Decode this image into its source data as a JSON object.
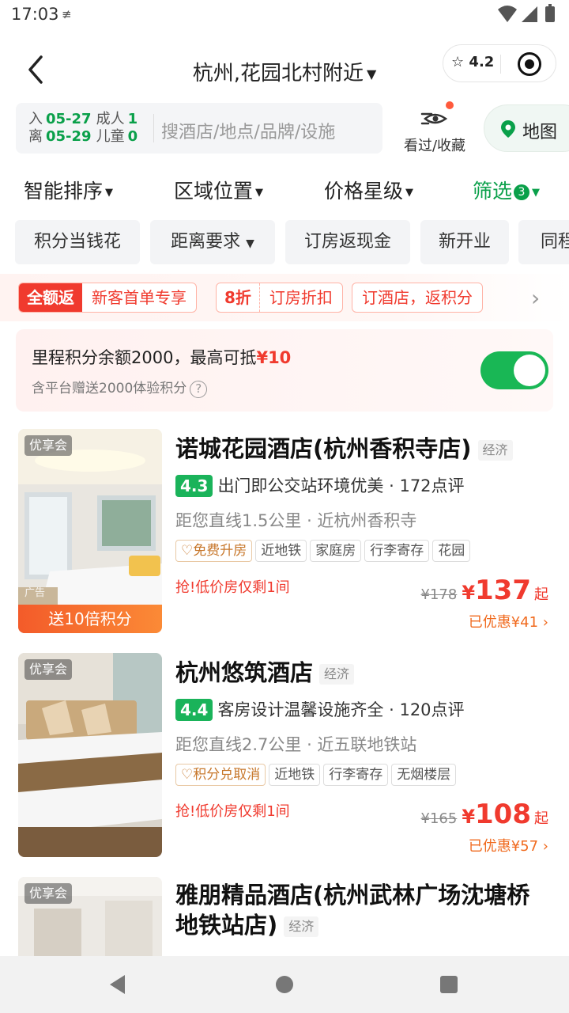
{
  "status_bar": {
    "time": "17:03",
    "device_icon": "≢",
    "icons": "▼◢▮"
  },
  "header": {
    "title": "杭州,花园北村附近",
    "capsule_rating": "4.2"
  },
  "search": {
    "checkin_label": "入",
    "checkin_date": "05-27",
    "adult_label": "成人",
    "adult_count": "1",
    "checkout_label": "离",
    "checkout_date": "05-29",
    "child_label": "儿童",
    "child_count": "0",
    "placeholder": "搜酒店/地点/品牌/设施",
    "seen_label": "看过/收藏",
    "map_label": "地图"
  },
  "sort_bar": {
    "smart": "智能排序",
    "area": "区域位置",
    "price": "价格星级",
    "filter": "筛选",
    "filter_count": "3"
  },
  "chips": [
    "积分当钱花",
    "距离要求",
    "订房返现金",
    "新开业",
    "同程"
  ],
  "promo": {
    "tag1_strong": "全额返",
    "tag1_text": "新客首单专享",
    "tag2_strong": "8折",
    "tag2_text": "订房折扣",
    "tag3_text": "订酒店，返积分"
  },
  "points": {
    "line1_prefix": "里程积分余额2000，最高可抵",
    "line1_amount": "¥10",
    "line2": "含平台赠送2000体验积分",
    "toggle_on": true
  },
  "hotels": [
    {
      "badge": "优享会",
      "ad_label": "广告",
      "bonus": "送10倍积分",
      "name": "诺城花园酒店(杭州香积寺店)",
      "level": "经济",
      "score": "4.3",
      "comment": "出门即公交站环境优美 · 172点评",
      "distance": "距您直线1.5公里 · 近杭州香积寺",
      "tags": [
        "免费升房",
        "近地铁",
        "家庭房",
        "行李寄存",
        "花园"
      ],
      "urgent": "抢!低价房仅剩1间",
      "old_price": "¥178",
      "yen": "¥",
      "price": "137",
      "qi": "起",
      "saved": "已优惠¥41"
    },
    {
      "badge": "优享会",
      "name": "杭州悠筑酒店",
      "level": "经济",
      "score": "4.4",
      "comment": "客房设计温馨设施齐全 · 120点评",
      "distance": "距您直线2.7公里 · 近五联地铁站",
      "tags": [
        "积分兑取消",
        "近地铁",
        "行李寄存",
        "无烟楼层"
      ],
      "urgent": "抢!低价房仅剩1间",
      "old_price": "¥165",
      "yen": "¥",
      "price": "108",
      "qi": "起",
      "saved": "已优惠¥57"
    },
    {
      "badge": "优享会",
      "name_line1": "雅朋精品酒店(杭州武林广场沈塘桥",
      "name_line2": "地铁站店)",
      "level": "经济"
    }
  ],
  "colors": {
    "green": "#0aa04a",
    "red": "#f03a2e",
    "orange": "#f06a1e"
  }
}
